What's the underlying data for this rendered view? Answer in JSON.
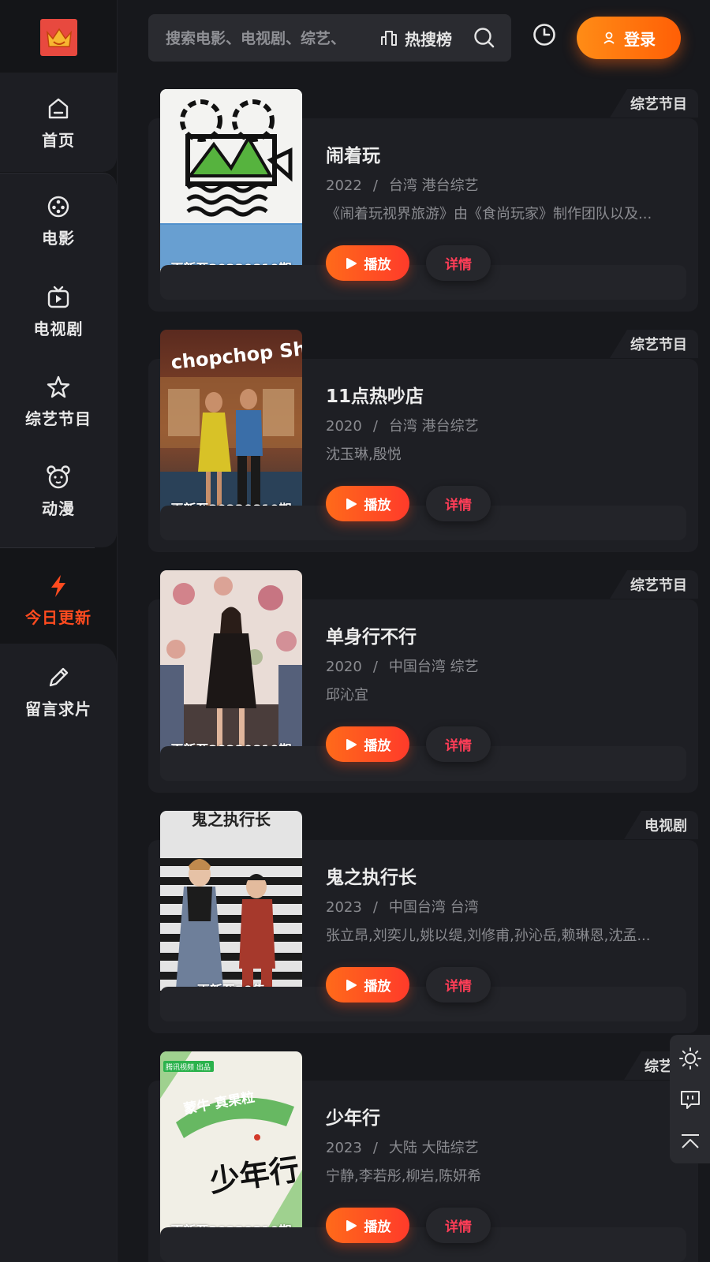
{
  "sidebar": {
    "logo_icon": "crown-logo",
    "items": [
      {
        "label": "首页",
        "icon": "home-icon"
      },
      {
        "label": "电影",
        "icon": "film-reel-icon"
      },
      {
        "label": "电视剧",
        "icon": "tv-icon"
      },
      {
        "label": "综艺节目",
        "icon": "star-outline-icon"
      },
      {
        "label": "动漫",
        "icon": "bear-icon"
      },
      {
        "label": "今日更新",
        "icon": "lightning-icon",
        "active": true
      },
      {
        "label": "留言求片",
        "icon": "pencil-icon"
      }
    ],
    "active_color": "#ff4b1f"
  },
  "header": {
    "search_placeholder": "搜索电影、电视剧、综艺、",
    "hot_label": "热搜榜",
    "login_label": "登录",
    "login_color": "#ff7a10"
  },
  "cards": [
    {
      "tag": "综艺节目",
      "title": "闹着玩",
      "year": "2022",
      "region": "台湾 港台综艺",
      "desc": "《闹着玩视界旅游》由《食尚玩家》制作团队以及...",
      "update": "更新至20230810期",
      "play": "播放",
      "detail": "详情"
    },
    {
      "tag": "综艺节目",
      "title": "11点热吵店",
      "year": "2020",
      "region": "台湾 港台综艺",
      "desc": "沈玉琳,殷悦",
      "update": "更新至20230810期",
      "play": "播放",
      "detail": "详情"
    },
    {
      "tag": "综艺节目",
      "title": "单身行不行",
      "year": "2020",
      "region": "中国台湾 综艺",
      "desc": "邱沁宜",
      "update": "更新至20230810期",
      "play": "播放",
      "detail": "详情"
    },
    {
      "tag": "电视剧",
      "title": "鬼之执行长",
      "year": "2023",
      "region": "中国台湾 台湾",
      "desc": "张立昂,刘奕儿,姚以缇,刘修甫,孙沁岳,赖琳恩,沈孟...",
      "update": "更新至39集",
      "play": "播放",
      "detail": "详情"
    },
    {
      "tag": "综艺节",
      "title": "少年行",
      "year": "2023",
      "region": "大陆 大陆综艺",
      "desc": "宁静,李若彤,柳岩,陈妍希",
      "update": "更新至20230810期",
      "play": "播放",
      "detail": "详情"
    }
  ],
  "poster_texts": {
    "poster2_logo": "chopchop Show",
    "poster4_title": "鬼之执行长",
    "poster5_badge": "腾讯视频 出品",
    "poster5_brand": "蒙牛 真果粒",
    "poster5_title": "少年行"
  },
  "separator": "/",
  "float_tools": [
    "sun-icon",
    "feedback-icon",
    "back-to-top-icon"
  ]
}
